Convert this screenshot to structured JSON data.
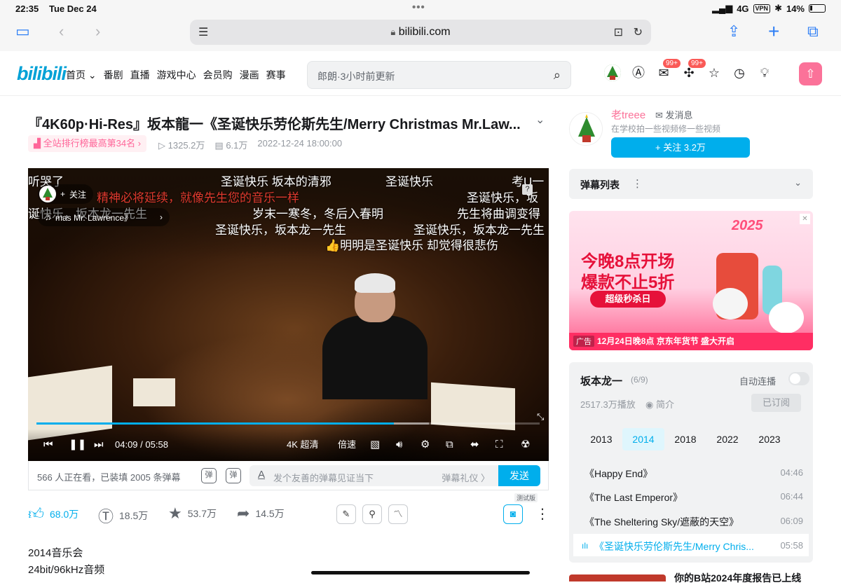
{
  "status_bar": {
    "time": "22:35",
    "date": "Tue Dec 24",
    "network": "4G",
    "vpn": "VPN",
    "battery": "14%"
  },
  "safari": {
    "url": "bilibili.com"
  },
  "header": {
    "logo": "bilibili",
    "nav": [
      "首页",
      "番剧",
      "直播",
      "游戏中心",
      "会员购",
      "漫画",
      "赛事"
    ],
    "search_placeholder": "郎朗·3小时前更新",
    "badges": [
      "99+",
      "99+"
    ]
  },
  "video": {
    "title": "『4K60p·Hi-Res』坂本龍一《圣诞快乐劳伦斯先生/Merry Christmas Mr.Law...",
    "rank_badge": "全站排行榜最高第34名",
    "views": "1325.2万",
    "danmaku_count": "6.1万",
    "publish_time": "2022-12-24 18:00:00"
  },
  "player": {
    "follow_label": "关注",
    "song_label": "mas Mr. Lawrence》",
    "danmaku": [
      {
        "text": "听哭了",
        "color": "white"
      },
      {
        "text": "圣诞快乐  坂本的清邪",
        "color": "white"
      },
      {
        "text": "圣诞快乐",
        "color": "white"
      },
      {
        "text": "考U一",
        "color": "white"
      },
      {
        "text": "精神必将延续，就像先生您的音乐一样",
        "color": "red"
      },
      {
        "text": "圣诞快乐，坂",
        "color": "white"
      },
      {
        "text": "诞快乐，坂本龙一先生",
        "color": "white"
      },
      {
        "text": "岁末一寒冬，冬后入春明",
        "color": "white"
      },
      {
        "text": "先生将曲调变得",
        "color": "white"
      },
      {
        "text": "圣诞快乐，坂本龙一先生",
        "color": "white"
      },
      {
        "text": "圣诞快乐，坂本龙一先生",
        "color": "white"
      },
      {
        "text": "👍明明是圣诞快乐 却觉得很悲伤",
        "color": "white"
      }
    ],
    "current_time": "04:09",
    "duration": "05:58",
    "quality": "4K 超清",
    "speed": "倍速",
    "progress_fraction": 0.71,
    "buffered_fraction": 0.78
  },
  "danmaku_bar": {
    "viewers_text": "566 人正在看，已装填 2005 条弹幕",
    "danmaku_toggle": "弹",
    "danmaku_settings": "弹",
    "input_placeholder": "发个友善的弹幕见证当下",
    "etiquette": "弹幕礼仪 〉",
    "send": "发送"
  },
  "actions": {
    "like": "68.0万",
    "coin": "18.5万",
    "favorite": "53.7万",
    "share": "14.5万",
    "test_badge": "测试版"
  },
  "description": [
    "2014音乐会",
    "24bit/96kHz音频"
  ],
  "uploader": {
    "name": "老treee",
    "message": "发消息",
    "bio": "在学校拍一些视频修一些视频",
    "follow": "+ 关注 3.2万"
  },
  "danmaku_list": {
    "title": "弹幕列表"
  },
  "ad": {
    "year": "2025",
    "line1": "今晚8点开场",
    "line2": "爆款不止5折",
    "pill": "超级秒杀日",
    "tag": "广告",
    "bottom": "12月24日晚8点  京东年货节  盛大开启"
  },
  "series": {
    "name": "坂本龙一",
    "index": "(6/9)",
    "autoplay": "自动连播",
    "plays": "2517.3万播放",
    "intro": "简介",
    "subscribe": "已订阅",
    "years": [
      "2013",
      "2014",
      "2018",
      "2022",
      "2023"
    ],
    "active_year": "2014",
    "episodes": [
      {
        "title": "《Happy End》",
        "duration": "04:46"
      },
      {
        "title": "《The Last Emperor》",
        "duration": "06:44"
      },
      {
        "title": "《The Sheltering Sky/遮蔽的天空》",
        "duration": "06:09"
      },
      {
        "title": "《圣诞快乐劳伦斯先生/Merry Chris...",
        "duration": "05:58"
      }
    ]
  },
  "promo": {
    "text": "你的B站2024年度报告已上线"
  },
  "colors": {
    "accent": "#00aeec",
    "pink": "#fb7299",
    "red_danmaku": "#e03a2e"
  }
}
